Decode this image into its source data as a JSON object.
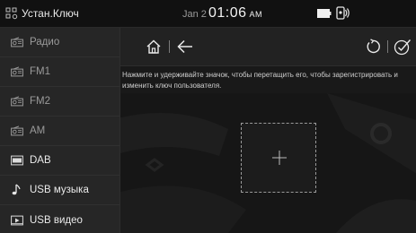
{
  "statusbar": {
    "app_title": "Устан.Ключ",
    "date": "Jan 2",
    "time": "01:06",
    "ampm": "AM"
  },
  "sidebar": {
    "items": [
      {
        "label": "Радио",
        "icon": "radio-icon"
      },
      {
        "label": "FM1",
        "icon": "radio-icon"
      },
      {
        "label": "FM2",
        "icon": "radio-icon"
      },
      {
        "label": "AM",
        "icon": "radio-icon"
      },
      {
        "label": "DAB",
        "icon": "dab-icon"
      },
      {
        "label": "USB музыка",
        "icon": "music-note-icon"
      },
      {
        "label": "USB видео",
        "icon": "video-icon"
      }
    ]
  },
  "main": {
    "hint": "Нажмите и удерживайте значок, чтобы перетащить его, чтобы зарегистрировать и изменить ключ пользователя."
  },
  "colors": {
    "background": "#191919",
    "sidebar": "#262626",
    "statusbar": "#111111",
    "text": "#e6e6e6",
    "dashed_border": "#9a9a9a"
  }
}
